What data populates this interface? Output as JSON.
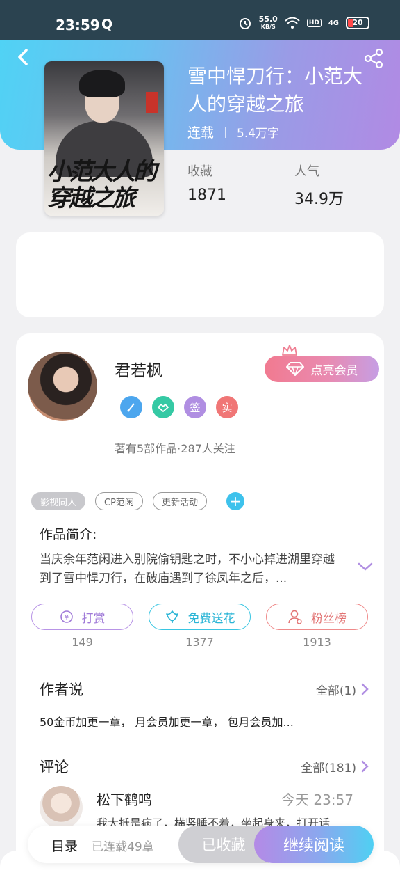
{
  "status_bar": {
    "time": "23:59",
    "app_icon": "Q",
    "net_speed_value": "55.0",
    "net_speed_unit": "KB/S",
    "hd": "HD",
    "signal": "4G",
    "battery": "20"
  },
  "book": {
    "title": "雪中悍刀行：小范大人的穿越之旅",
    "status": "连载",
    "word_count": "5.4万字",
    "cover_title": "小范大人的穿越之旅",
    "stats": {
      "favorites_label": "收藏",
      "favorites_value": "1871",
      "popularity_label": "人气",
      "popularity_value": "34.9万"
    }
  },
  "author": {
    "name": "君若枫",
    "vip_button": "点亮会员",
    "badges": [
      "",
      "",
      "签",
      "实"
    ],
    "summary": "著有5部作品·287人关注"
  },
  "tags": [
    "影视同人",
    "CP范闲",
    "更新活动"
  ],
  "intro": {
    "label": "作品简介:",
    "text": "当庆余年范闲进入别院偷钥匙之时，不小心掉进湖里穿越到了雪中悍刀行，在破庙遇到了徐凤年之后，..."
  },
  "actions": [
    {
      "label": "打赏",
      "count": "149"
    },
    {
      "label": "免费送花",
      "count": "1377"
    },
    {
      "label": "粉丝榜",
      "count": "1913"
    }
  ],
  "author_says": {
    "title": "作者说",
    "more": "全部(1)",
    "text": "50金币加更一章， 月会员加更一章， 包月会员加..."
  },
  "comments": {
    "title": "评论",
    "more": "全部(181)",
    "first": {
      "user": "松下鹤鸣",
      "time": "今天 23:57",
      "text": "我大抵是病了，横竖睡不着，坐起身来，打开话"
    }
  },
  "bottom_bar": {
    "toc": "目录",
    "chapters": "已连载49章",
    "collected": "已收藏",
    "continue": "继续阅读"
  },
  "colors": {
    "accent_cyan": "#4fd3f5",
    "accent_purple": "#b18ae4",
    "vip_pink": "#f17a90"
  }
}
